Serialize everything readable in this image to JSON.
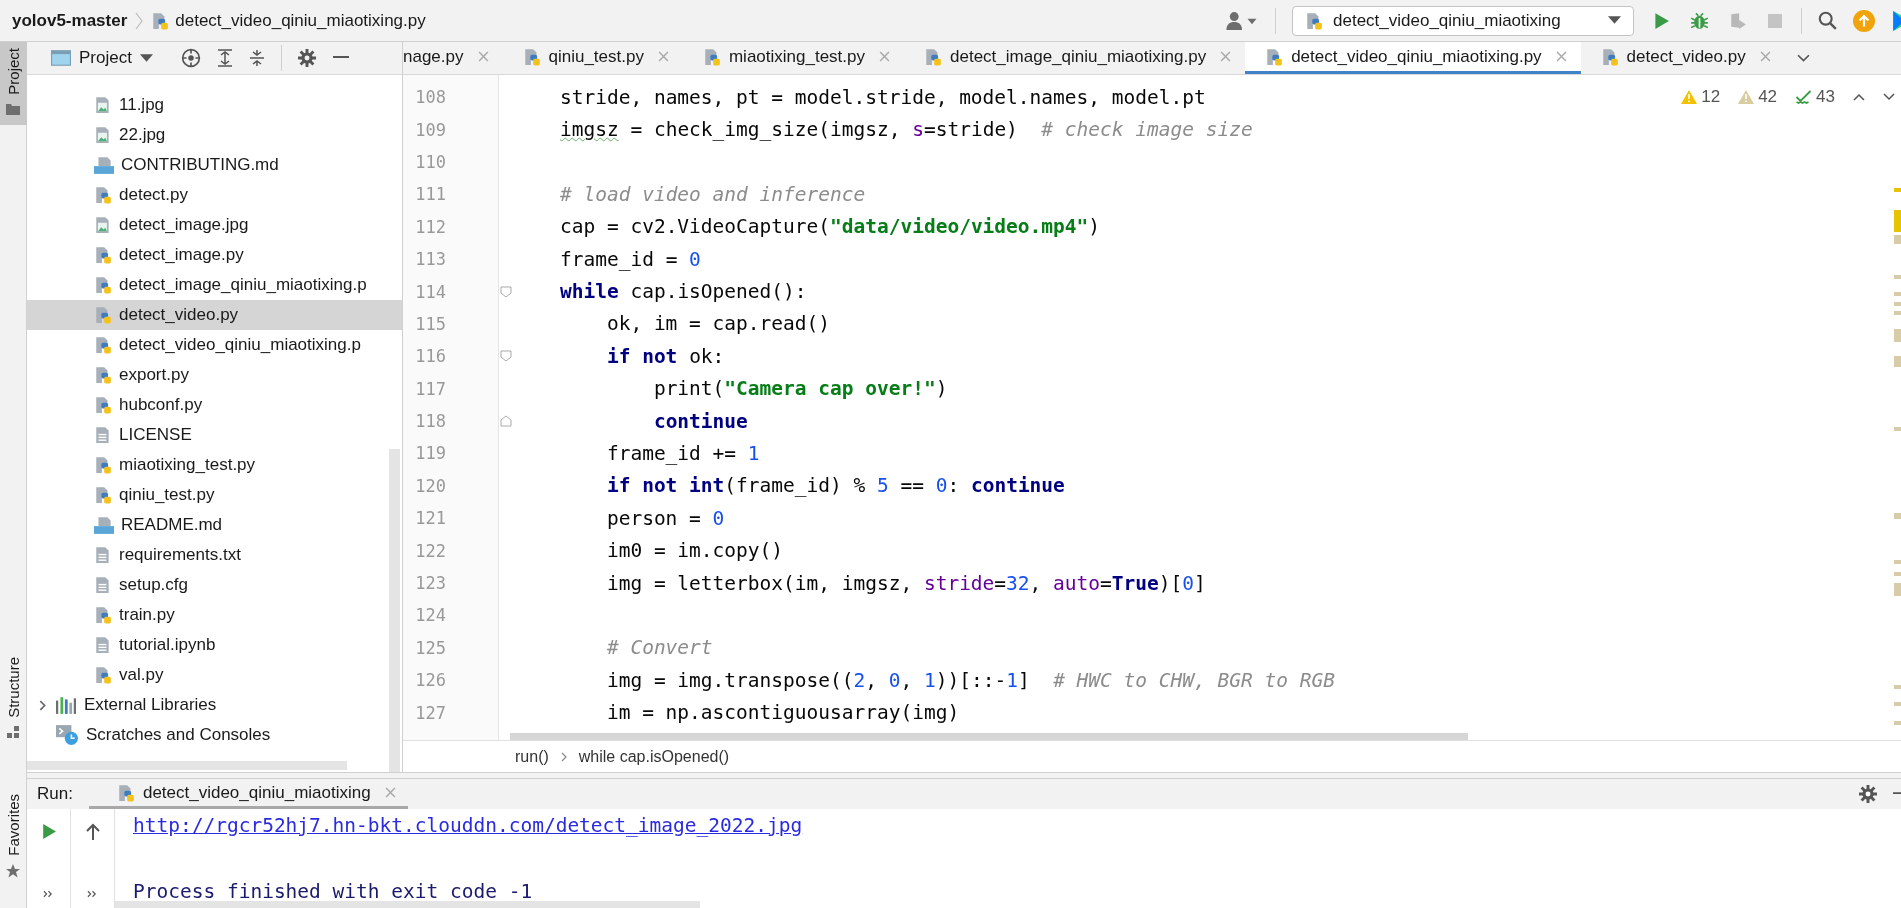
{
  "window": {
    "project": "yolov5-master",
    "file": "detect_video_qiniu_miaotixing.py"
  },
  "run_config": "detect_video_qiniu_miaotixing",
  "toolbar": [
    {
      "kind": "run",
      "disabled": false
    },
    {
      "kind": "debug",
      "disabled": false
    },
    {
      "kind": "coverage",
      "disabled": true
    },
    {
      "kind": "stop",
      "disabled": true
    }
  ],
  "side_tabs": [
    {
      "label": "Project",
      "kind": "project",
      "selected": true
    },
    {
      "label": "Structure",
      "kind": "structure",
      "selected": false
    },
    {
      "label": "Favorites",
      "kind": "favorites",
      "selected": false
    }
  ],
  "project_panel": {
    "title": "Project",
    "items": [
      {
        "label": "11.jpg",
        "kind": "image",
        "selected": false
      },
      {
        "label": "22.jpg",
        "kind": "image",
        "selected": false
      },
      {
        "label": "CONTRIBUTING.md",
        "kind": "md",
        "selected": false
      },
      {
        "label": "detect.py",
        "kind": "python",
        "selected": false
      },
      {
        "label": "detect_image.jpg",
        "kind": "image",
        "selected": false
      },
      {
        "label": "detect_image.py",
        "kind": "python",
        "selected": false
      },
      {
        "label": "detect_image_qiniu_miaotixing.p",
        "kind": "python",
        "selected": false
      },
      {
        "label": "detect_video.py",
        "kind": "python",
        "selected": true
      },
      {
        "label": "detect_video_qiniu_miaotixing.p",
        "kind": "python",
        "selected": false
      },
      {
        "label": "export.py",
        "kind": "python",
        "selected": false
      },
      {
        "label": "hubconf.py",
        "kind": "python",
        "selected": false
      },
      {
        "label": "LICENSE",
        "kind": "text",
        "selected": false
      },
      {
        "label": "miaotixing_test.py",
        "kind": "python",
        "selected": false
      },
      {
        "label": "qiniu_test.py",
        "kind": "python",
        "selected": false
      },
      {
        "label": "README.md",
        "kind": "md",
        "selected": false
      },
      {
        "label": "requirements.txt",
        "kind": "text",
        "selected": false
      },
      {
        "label": "setup.cfg",
        "kind": "text",
        "selected": false
      },
      {
        "label": "train.py",
        "kind": "python",
        "selected": false
      },
      {
        "label": "tutorial.ipynb",
        "kind": "text",
        "selected": false
      },
      {
        "label": "val.py",
        "kind": "python",
        "selected": false
      }
    ],
    "groups": [
      {
        "label": "External Libraries",
        "kind": "libraries",
        "expanded": false
      },
      {
        "label": "Scratches and Consoles",
        "kind": "scratches"
      }
    ]
  },
  "editor_tabs": [
    {
      "label": "nage.py",
      "selected": false
    },
    {
      "label": "qiniu_test.py",
      "selected": false
    },
    {
      "label": "miaotixing_test.py",
      "selected": false
    },
    {
      "label": "detect_image_qiniu_miaotixing.py",
      "selected": false
    },
    {
      "label": "detect_video_qiniu_miaotixing.py",
      "selected": true
    },
    {
      "label": "detect_video.py",
      "selected": false
    }
  ],
  "inspections": [
    {
      "kind": "warning",
      "count": "12"
    },
    {
      "kind": "weak_warning",
      "count": "42"
    },
    {
      "kind": "typo",
      "count": "43"
    }
  ],
  "code": [
    {
      "number": "108",
      "tokens": [
        {
          "kind": "plain",
          "text": "    stride, names, pt = model.stride, model.names, model.pt"
        }
      ]
    },
    {
      "number": "109",
      "tokens": [
        {
          "kind": "typo",
          "text": "    imgsz"
        },
        {
          "kind": "plain",
          "text": " = check_img_size(imgsz, "
        },
        {
          "kind": "kwarg",
          "text": "s"
        },
        {
          "kind": "plain",
          "text": "=stride)  "
        },
        {
          "kind": "comment",
          "text": "# check image size"
        }
      ]
    },
    {
      "number": "110"
    },
    {
      "number": "111",
      "tokens": [
        {
          "kind": "comment",
          "text": "    # load video and inference"
        }
      ]
    },
    {
      "number": "112",
      "tokens": [
        {
          "kind": "plain",
          "text": "    cap = cv2.VideoCapture("
        },
        {
          "kind": "str",
          "text": "\"data/video/video.mp4\""
        },
        {
          "kind": "plain",
          "text": ")"
        }
      ]
    },
    {
      "number": "113",
      "tokens": [
        {
          "kind": "plain",
          "text": "    frame_id = "
        },
        {
          "kind": "num",
          "text": "0"
        }
      ]
    },
    {
      "number": "114",
      "fold_start": true,
      "tokens": [
        {
          "kind": "kw",
          "text": "    while"
        },
        {
          "kind": "plain",
          "text": " cap.isOpened():"
        }
      ]
    },
    {
      "number": "115",
      "tokens": [
        {
          "kind": "plain",
          "text": "        ok, im = cap.read()"
        }
      ]
    },
    {
      "number": "116",
      "fold_start": true,
      "tokens": [
        {
          "kind": "kw",
          "text": "        if not"
        },
        {
          "kind": "plain",
          "text": " ok:"
        }
      ]
    },
    {
      "number": "117",
      "tokens": [
        {
          "kind": "plain",
          "text": "            print("
        },
        {
          "kind": "str",
          "text": "\"Camera cap over!\""
        },
        {
          "kind": "plain",
          "text": ")"
        }
      ]
    },
    {
      "number": "118",
      "fold_end": true,
      "tokens": [
        {
          "kind": "kw",
          "text": "            continue"
        }
      ]
    },
    {
      "number": "119",
      "tokens": [
        {
          "kind": "plain",
          "text": "        frame_id += "
        },
        {
          "kind": "num",
          "text": "1"
        }
      ]
    },
    {
      "number": "120",
      "tokens": [
        {
          "kind": "kw",
          "text": "        if not int"
        },
        {
          "kind": "plain",
          "text": "(frame_id) % "
        },
        {
          "kind": "num",
          "text": "5"
        },
        {
          "kind": "plain",
          "text": " == "
        },
        {
          "kind": "num",
          "text": "0"
        },
        {
          "kind": "plain",
          "text": ": "
        },
        {
          "kind": "kw",
          "text": "continue"
        }
      ]
    },
    {
      "number": "121",
      "tokens": [
        {
          "kind": "plain",
          "text": "        person = "
        },
        {
          "kind": "num",
          "text": "0"
        }
      ]
    },
    {
      "number": "122",
      "tokens": [
        {
          "kind": "plain",
          "text": "        im0 = im.copy()"
        }
      ]
    },
    {
      "number": "123",
      "tokens": [
        {
          "kind": "plain",
          "text": "        img = letterbox(im, imgsz, "
        },
        {
          "kind": "kwarg",
          "text": "stride"
        },
        {
          "kind": "plain",
          "text": "="
        },
        {
          "kind": "num",
          "text": "32"
        },
        {
          "kind": "plain",
          "text": ", "
        },
        {
          "kind": "kwarg",
          "text": "auto"
        },
        {
          "kind": "plain",
          "text": "="
        },
        {
          "kind": "kw",
          "text": "True"
        },
        {
          "kind": "plain",
          "text": ")["
        },
        {
          "kind": "num",
          "text": "0"
        },
        {
          "kind": "plain",
          "text": "]"
        }
      ]
    },
    {
      "number": "124"
    },
    {
      "number": "125",
      "tokens": [
        {
          "kind": "comment",
          "text": "        # Convert"
        }
      ]
    },
    {
      "number": "126",
      "tokens": [
        {
          "kind": "plain",
          "text": "        img = img.transpose(("
        },
        {
          "kind": "num",
          "text": "2"
        },
        {
          "kind": "plain",
          "text": ", "
        },
        {
          "kind": "num",
          "text": "0"
        },
        {
          "kind": "plain",
          "text": ", "
        },
        {
          "kind": "num",
          "text": "1"
        },
        {
          "kind": "plain",
          "text": "))[::-"
        },
        {
          "kind": "num",
          "text": "1"
        },
        {
          "kind": "plain",
          "text": "]  "
        },
        {
          "kind": "comment",
          "text": "# HWC to CHW, BGR to RGB"
        }
      ]
    },
    {
      "number": "127",
      "tokens": [
        {
          "kind": "plain",
          "text": "        im = np.ascontiguousarray(img)"
        }
      ]
    }
  ],
  "breadcrumbs": [
    "run()",
    "while cap.isOpened()"
  ],
  "run_panel": {
    "label": "Run:",
    "tab": {
      "label": "detect_video_qiniu_miaotixing",
      "selected": true
    },
    "output": [
      {
        "kind": "link",
        "text": "http://rgcr52hj7.hn-bkt.clouddn.com/detect_image_2022.jpg"
      },
      {
        "kind": "blank"
      },
      {
        "kind": "text",
        "text": "Process finished with exit code -1"
      }
    ]
  }
}
